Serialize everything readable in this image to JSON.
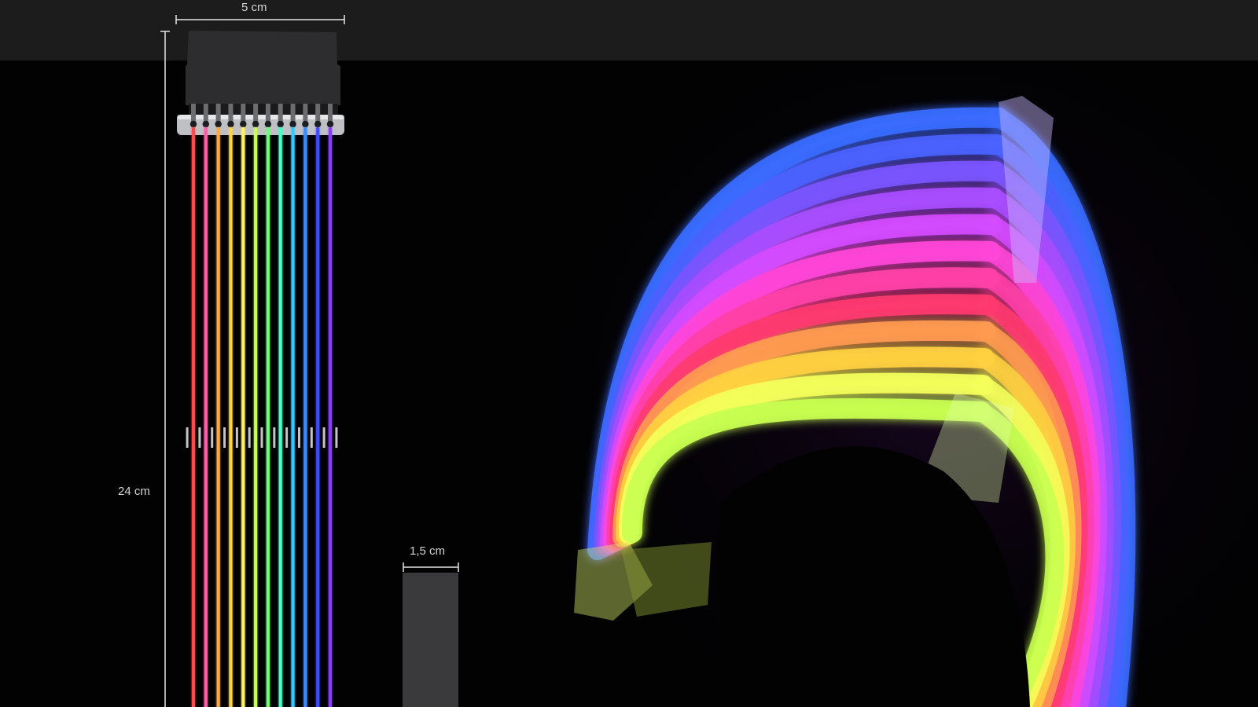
{
  "dimensions": {
    "width_label": "5 cm",
    "length_label": "24 cm",
    "thickness_label": "1,5 cm"
  },
  "colors": {
    "top_band": "#1c1c1d",
    "background": "#020203",
    "connector": "#2d2d2f",
    "side_profile": "#3a3a3c",
    "dimension_line": "#e6e6e6",
    "wires": [
      "#ff4c4c",
      "#ff5fa8",
      "#ffa840",
      "#ffd24a",
      "#fff06a",
      "#c6ff5a",
      "#6cff7a",
      "#40ffc8",
      "#38c8ff",
      "#3a8cff",
      "#3f4bff",
      "#8a3cff"
    ]
  },
  "icons": {
    "connector": "atx-24pin-connector",
    "comb": "cable-comb",
    "product_photo": "rgb-cable-bundle"
  }
}
